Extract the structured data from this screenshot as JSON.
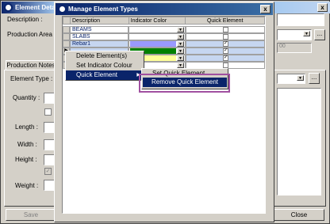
{
  "bg_window": {
    "title": "Element Deta",
    "description_label": "Description :",
    "production_area_label": "Production Area :",
    "tab_label": "Production Notes",
    "element_type_label": "Element Type :",
    "quantity_label": "Quantity :",
    "length_label": "Length :",
    "width_label": "Width :",
    "height_label": "Height :",
    "weight_label": "Weight :",
    "save_label": "Save",
    "close_label": "Close",
    "right_value": "00",
    "ellipsis": "..."
  },
  "dialog": {
    "title": "Manage Element Types",
    "close_glyph": "x",
    "columns": [
      "Description",
      "Indicator Color",
      "Quick Element"
    ],
    "rows": [
      {
        "description": "BEAMS",
        "color": "#ffffff",
        "quick": false
      },
      {
        "description": "SLABS",
        "color": "#ffffff",
        "quick": false
      },
      {
        "description": "Rebar1",
        "color": "#9999ff",
        "quick": true
      },
      {
        "description": "",
        "color": "#008000",
        "quick": true
      },
      {
        "description": "",
        "color": "#ffff99",
        "quick": true
      },
      {
        "description": "",
        "color": "#ffffff",
        "quick": false
      }
    ],
    "row_marker": "▶",
    "new_row_marker": "*"
  },
  "context_menu": {
    "items": [
      "Delete Element(s)",
      "Set Indicator Colour",
      "Quick Element"
    ],
    "submenu_arrow": "▶"
  },
  "submenu": {
    "items": [
      "Set Quick Element",
      "Remove Quick Element"
    ]
  },
  "colors": {
    "highlight": "#a050a0",
    "selection": "#0a246a",
    "row_selected": "#c6d6f0"
  }
}
